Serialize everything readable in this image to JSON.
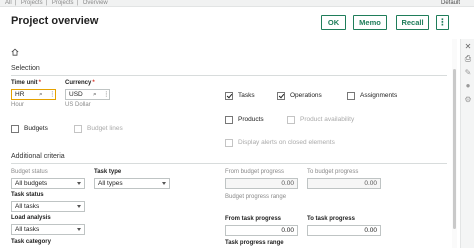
{
  "breadcrumb": [
    "All",
    "Projects",
    "Projects",
    "Overview"
  ],
  "default_link": "Default",
  "header": {
    "title": "Project overview",
    "ok_label": "OK",
    "memo_label": "Memo",
    "recall_label": "Recall",
    "more_label": "⋮"
  },
  "selection": {
    "title": "Selection",
    "time_unit": {
      "label": "Time unit",
      "value": "HR",
      "hint": "Hour"
    },
    "currency": {
      "label": "Currency",
      "value": "USD",
      "hint": "US Dollar"
    },
    "budgets": {
      "label": "Budgets",
      "checked": false
    },
    "budget_lines": {
      "label": "Budget lines",
      "checked": false
    },
    "tasks": {
      "label": "Tasks",
      "checked": true
    },
    "operations": {
      "label": "Operations",
      "checked": true
    },
    "assignments": {
      "label": "Assignments",
      "checked": false
    },
    "products": {
      "label": "Products",
      "checked": false
    },
    "product_availability": {
      "label": "Product availability",
      "checked": false
    },
    "display_alerts": {
      "label": "Display alerts on closed elements",
      "checked": false
    }
  },
  "criteria": {
    "title": "Additional criteria",
    "budget_status": {
      "label": "Budget status",
      "value": "All budgets"
    },
    "task_type": {
      "label": "Task type",
      "value": "All types"
    },
    "task_status": {
      "label": "Task status",
      "value": "All tasks"
    },
    "load_analysis": {
      "label": "Load analysis",
      "value": "All tasks"
    },
    "task_category": {
      "label": "Task category"
    },
    "from_budget_progress": {
      "label": "From budget progress",
      "value": "0.00"
    },
    "to_budget_progress": {
      "label": "To budget progress",
      "value": "0.00"
    },
    "budget_progress_range": {
      "label": "Budget progress range"
    },
    "from_task_progress": {
      "label": "From task progress",
      "value": "0.00"
    },
    "to_task_progress": {
      "label": "To task progress",
      "value": "0.00"
    },
    "task_progress_range": {
      "label": "Task progress range"
    }
  },
  "rail_icons": [
    "close-icon",
    "print-icon",
    "edit-icon",
    "comment-icon",
    "settings-icon"
  ],
  "colors": {
    "accent": "#1f7d5a",
    "focus": "#e5a100",
    "required": "#d8352a"
  }
}
